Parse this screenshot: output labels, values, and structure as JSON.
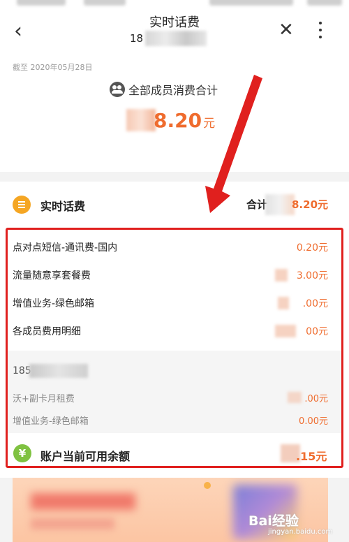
{
  "header": {
    "title": "实时话费",
    "subtitle": "18"
  },
  "summary": {
    "date": "截至 2020年05月28日",
    "members_label": "全部成员消费合计",
    "amount": "8.20",
    "unit": "元"
  },
  "section": {
    "title": "实时话费",
    "total_label": "合计",
    "total_value": "8.20元"
  },
  "items": [
    {
      "label": "点对点短信-通讯费-国内",
      "value": "0.20元"
    },
    {
      "label": "流量随意享套餐费",
      "value": "3.00元"
    },
    {
      "label": "增值业务-绿色邮箱",
      "value": ".00元"
    },
    {
      "label": "各成员费用明细",
      "value": "00元"
    }
  ],
  "member_detail": {
    "phone": "185",
    "items": [
      {
        "label": "沃+副卡月租费",
        "value": ".00元"
      },
      {
        "label": "增值业务-绿色邮箱",
        "value": "0.00元"
      }
    ]
  },
  "balance": {
    "icon_glyph": "¥",
    "label": "账户当前可用余额",
    "value": ".15元"
  },
  "watermark": {
    "brand": "Bai经验",
    "url": "jingyan.baidu.com"
  },
  "colors": {
    "accent": "#ef6c2e",
    "highlight": "#e0201e",
    "section_icon": "#f5a623",
    "balance_icon": "#7fc241"
  }
}
